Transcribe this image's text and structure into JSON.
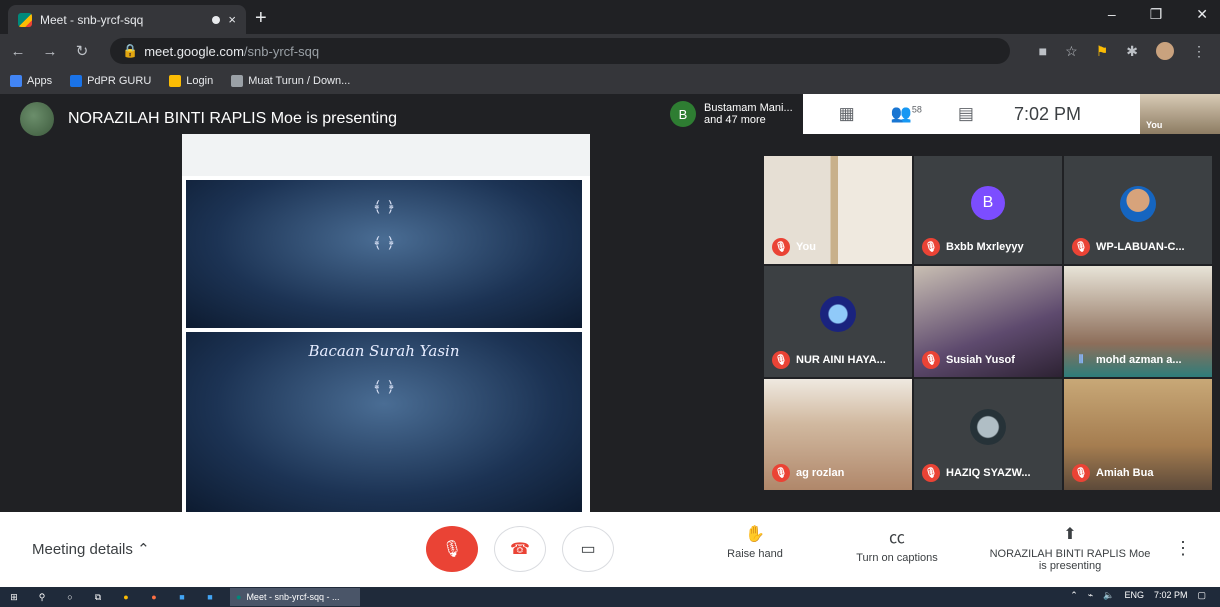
{
  "browser": {
    "tab_title": "Meet - snb-yrcf-sqq",
    "tab_close": "×",
    "new_tab": "+",
    "url_domain": "meet.google.com",
    "url_path": "/snb-yrcf-sqq",
    "window_controls": [
      "–",
      "❐",
      "✕"
    ],
    "bookmarks": [
      {
        "label": "Apps",
        "color": "#4285f4"
      },
      {
        "label": "PdPR GURU",
        "color": "#1a73e8"
      },
      {
        "label": "Login",
        "color": "#fbbc04"
      },
      {
        "label": "Muat Turun / Down...",
        "color": "#5f6368"
      }
    ]
  },
  "presenter_header": {
    "text": "NORAZILAH BINTI RAPLIS Moe is presenting"
  },
  "slide": {
    "page2_heading": "Bacaan Surah Yasin"
  },
  "topbar": {
    "people_line1": "Bustamam Mani...",
    "people_line2": "and 47 more",
    "avatar_letter": "B",
    "participants_count": "58",
    "time": "7:02 PM",
    "you_label": "You"
  },
  "tiles": [
    {
      "name": "You",
      "type": "room"
    },
    {
      "name": "Bxbb Mxrleyyy",
      "type": "letter",
      "letter": "B"
    },
    {
      "name": "WP-LABUAN-C...",
      "type": "photo"
    },
    {
      "name": "NUR AINI HAYA...",
      "type": "photo"
    },
    {
      "name": "Susiah Yusof",
      "type": "video"
    },
    {
      "name": "mohd azman a...",
      "type": "video-speaking"
    },
    {
      "name": "ag rozlan",
      "type": "video"
    },
    {
      "name": "HAZIQ SYAZW...",
      "type": "photo"
    },
    {
      "name": "Amiah Bua",
      "type": "video"
    }
  ],
  "controls": {
    "meeting_details": "Meeting details",
    "raise_hand": "Raise hand",
    "captions": "Turn on captions",
    "presenting_line1": "NORAZILAH BINTI RAPLIS Moe",
    "presenting_line2": "is presenting"
  },
  "taskbar": {
    "meet_item": "Meet - snb-yrcf-sqq - ...",
    "lang": "ENG",
    "time": "7:02 PM"
  }
}
